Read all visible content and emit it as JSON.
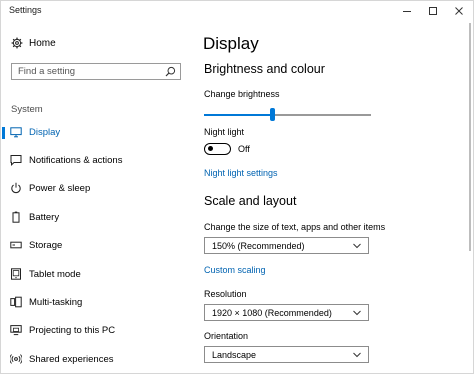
{
  "window": {
    "title": "Settings"
  },
  "sidebar": {
    "home_label": "Home",
    "search_placeholder": "Find a setting",
    "section_label": "System",
    "items": [
      {
        "label": "Display",
        "icon": "monitor-icon",
        "active": true
      },
      {
        "label": "Notifications & actions",
        "icon": "message-icon",
        "active": false
      },
      {
        "label": "Power & sleep",
        "icon": "power-icon",
        "active": false
      },
      {
        "label": "Battery",
        "icon": "battery-icon",
        "active": false
      },
      {
        "label": "Storage",
        "icon": "storage-icon",
        "active": false
      },
      {
        "label": "Tablet mode",
        "icon": "tablet-icon",
        "active": false
      },
      {
        "label": "Multi-tasking",
        "icon": "multitasking-icon",
        "active": false
      },
      {
        "label": "Projecting to this PC",
        "icon": "projecting-icon",
        "active": false
      },
      {
        "label": "Shared experiences",
        "icon": "shared-icon",
        "active": false
      }
    ]
  },
  "main": {
    "title": "Display",
    "brightness": {
      "heading": "Brightness and colour",
      "change_label": "Change brightness",
      "value_percent": 41,
      "night_light_label": "Night light",
      "night_light_state": "Off",
      "night_light_settings_link": "Night light settings"
    },
    "scale": {
      "heading": "Scale and layout",
      "size_label": "Change the size of text, apps and other items",
      "size_value": "150% (Recommended)",
      "custom_scaling_link": "Custom scaling",
      "resolution_label": "Resolution",
      "resolution_value": "1920 × 1080 (Recommended)",
      "orientation_label": "Orientation",
      "orientation_value": "Landscape"
    }
  },
  "colors": {
    "accent": "#0078d7",
    "link": "#0063b1"
  }
}
